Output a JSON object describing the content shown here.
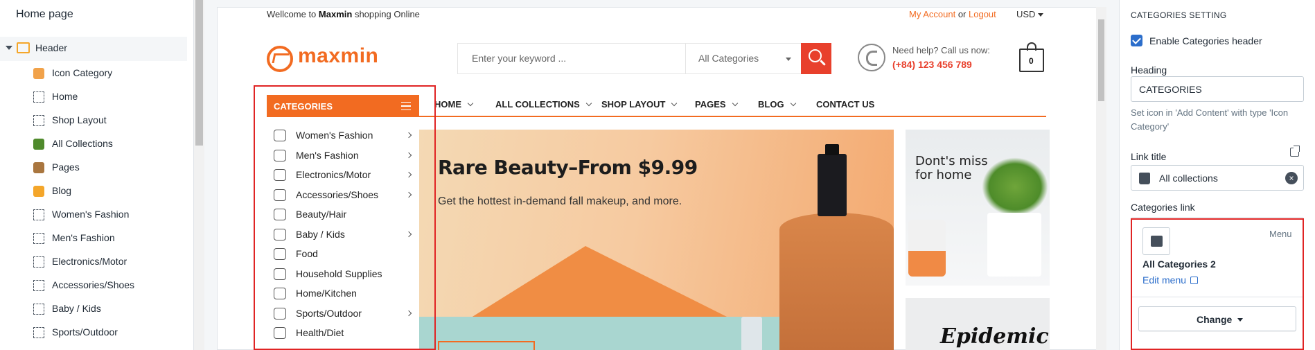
{
  "left_panel": {
    "title": "Home page",
    "header_label": "Header",
    "items": [
      {
        "label": "Icon Category",
        "icon": "icon-category-image"
      },
      {
        "label": "Home",
        "icon": "dashed-square-icon"
      },
      {
        "label": "Shop Layout",
        "icon": "dashed-square-icon"
      },
      {
        "label": "All Collections",
        "icon": "collections-image"
      },
      {
        "label": "Pages",
        "icon": "pages-image"
      },
      {
        "label": "Blog",
        "icon": "blog-image"
      },
      {
        "label": "Women's Fashion",
        "icon": "dashed-square-icon"
      },
      {
        "label": "Men's Fashion",
        "icon": "dashed-square-icon"
      },
      {
        "label": "Electronics/Motor",
        "icon": "dashed-square-icon"
      },
      {
        "label": "Accessories/Shoes",
        "icon": "dashed-square-icon"
      },
      {
        "label": "Baby / Kids",
        "icon": "dashed-square-icon"
      },
      {
        "label": "Sports/Outdoor",
        "icon": "dashed-square-icon"
      }
    ]
  },
  "store": {
    "welcome_prefix": "Wellcome to",
    "brand_bold": "Maxmin",
    "welcome_suffix": "shopping Online",
    "my_account": "My Account",
    "or": "or",
    "logout": "Logout",
    "currency": "USD",
    "logo_text": "maxmin",
    "search_placeholder": "Enter your keyword ...",
    "search_category": "All Categories",
    "help_text": "Need help? Call us now:",
    "hotline": "(+84) 123 456 789",
    "cart_count": "0",
    "categories_title": "CATEGORIES",
    "nav": [
      {
        "label": "HOME",
        "has_dropdown": true
      },
      {
        "label": "ALL COLLECTIONS",
        "has_dropdown": true
      },
      {
        "label": "SHOP LAYOUT",
        "has_dropdown": true
      },
      {
        "label": "PAGES",
        "has_dropdown": true
      },
      {
        "label": "BLOG",
        "has_dropdown": true
      },
      {
        "label": "CONTACT US",
        "has_dropdown": false
      }
    ],
    "categories": [
      {
        "label": "Women's Fashion",
        "has_sub": true
      },
      {
        "label": "Men's Fashion",
        "has_sub": true
      },
      {
        "label": "Electronics/Motor",
        "has_sub": true
      },
      {
        "label": "Accessories/Shoes",
        "has_sub": true
      },
      {
        "label": "Beauty/Hair",
        "has_sub": false
      },
      {
        "label": "Baby / Kids",
        "has_sub": true
      },
      {
        "label": "Food",
        "has_sub": false
      },
      {
        "label": "Household Supplies",
        "has_sub": false
      },
      {
        "label": "Home/Kitchen",
        "has_sub": false
      },
      {
        "label": "Sports/Outdoor",
        "has_sub": true
      },
      {
        "label": "Health/Diet",
        "has_sub": false
      }
    ],
    "banner": {
      "heading": "Rare Beauty–From $9.99",
      "subtext": "Get the hottest in-demand fall makeup, and more."
    },
    "side_banner_1": "Dont's miss for home",
    "side_banner_2": "Epidemic"
  },
  "right_panel": {
    "section_title": "CATEGORIES SETTING",
    "enable_label": "Enable Categories header",
    "enable_checked": true,
    "heading_label": "Heading",
    "heading_value": "CATEGORIES",
    "hint": "Set icon in 'Add Content' with type 'Icon Category'",
    "link_title_label": "Link title",
    "link_title_value": "All collections",
    "categories_link_label": "Categories link",
    "card_menu": "Menu",
    "card_title": "All Categories 2",
    "edit_menu": "Edit menu",
    "change_button": "Change"
  },
  "colors": {
    "accent": "#f26b21",
    "search_button": "#e8402c",
    "admin_blue": "#2c6ecb",
    "highlight_red": "#e02424"
  }
}
